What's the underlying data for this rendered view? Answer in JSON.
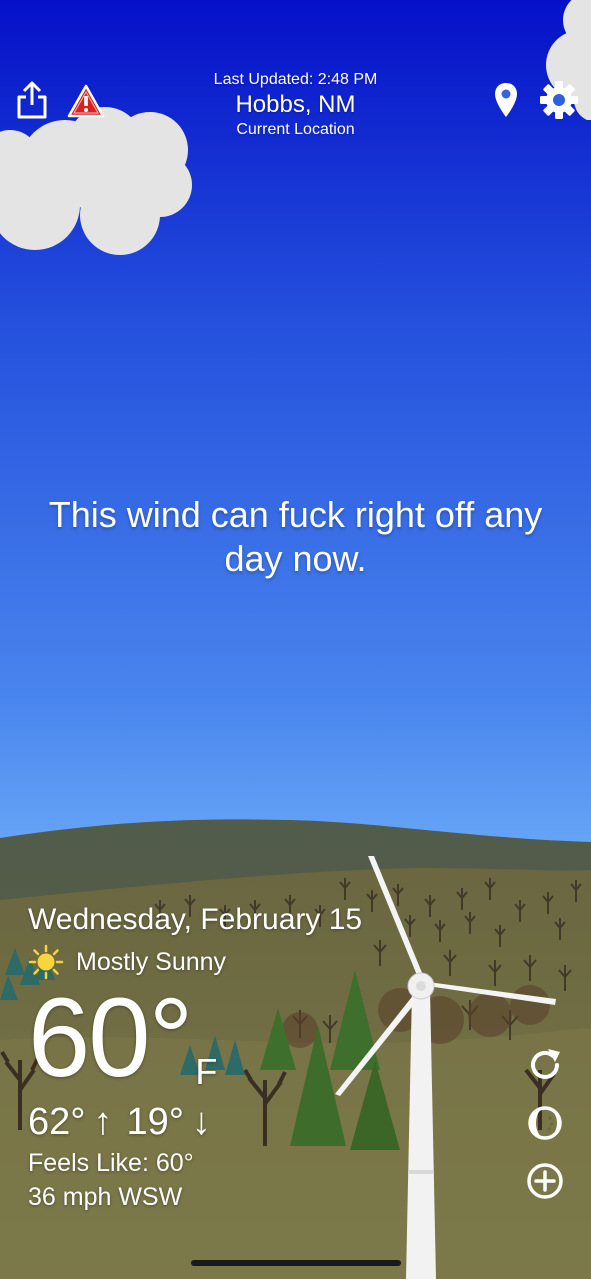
{
  "header": {
    "last_updated": "Last Updated: 2:48 PM",
    "location_name": "Hobbs, NM",
    "location_sub": "Current Location",
    "icons": [
      "share-icon",
      "alert-triangle-icon",
      "location-pin-icon",
      "gear-icon"
    ]
  },
  "message": "This wind can fuck right off any day now.",
  "weather": {
    "date": "Wednesday, February 15",
    "condition_icon": "sun-icon",
    "condition": "Mostly Sunny",
    "temperature": "60°",
    "unit": "F",
    "high": "62°",
    "high_arrow": "↑",
    "low": "19°",
    "low_arrow": "↓",
    "feels_like": "Feels Like: 60°",
    "wind": "36 mph WSW"
  },
  "side_buttons": [
    "refresh-icon",
    "theme-toggle-icon",
    "add-icon"
  ],
  "colors": {
    "sky_top": "#0510c8",
    "sky_bottom": "#70b0fa",
    "ground": "#6b6a3e",
    "hills": "#4d5845",
    "tree_green": "#3f6e2c"
  }
}
